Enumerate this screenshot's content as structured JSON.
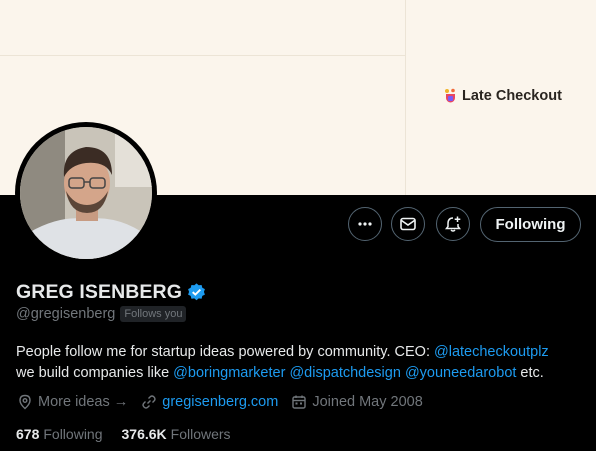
{
  "banner": {
    "brand_name": "Late Checkout"
  },
  "actions": {
    "more_icon": "more-horizontal-icon",
    "message_icon": "envelope-icon",
    "notify_icon": "bell-plus-icon",
    "following_label": "Following"
  },
  "profile": {
    "display_name": "GREG ISENBERG",
    "verified": true,
    "handle": "@gregisenberg",
    "follows_you": "Follows you",
    "bio": {
      "text1": "People follow me for startup ideas powered by community. CEO: ",
      "mention1": "@latecheckoutplz",
      "text2": "we build companies like ",
      "mention2": "@boringmarketer",
      "mention3": "@dispatchdesign",
      "mention4": "@youneedarobot",
      "text3": " etc."
    },
    "location": "More ideas →",
    "website": "gregisenberg.com",
    "joined": "Joined May 2008",
    "following_count": "678",
    "following_label": "Following",
    "followers_count": "376.6K",
    "followers_label": "Followers"
  },
  "colors": {
    "accent": "#1d9bf0",
    "background": "#000000",
    "banner": "#fbf5ec",
    "muted_text": "#71767b"
  }
}
